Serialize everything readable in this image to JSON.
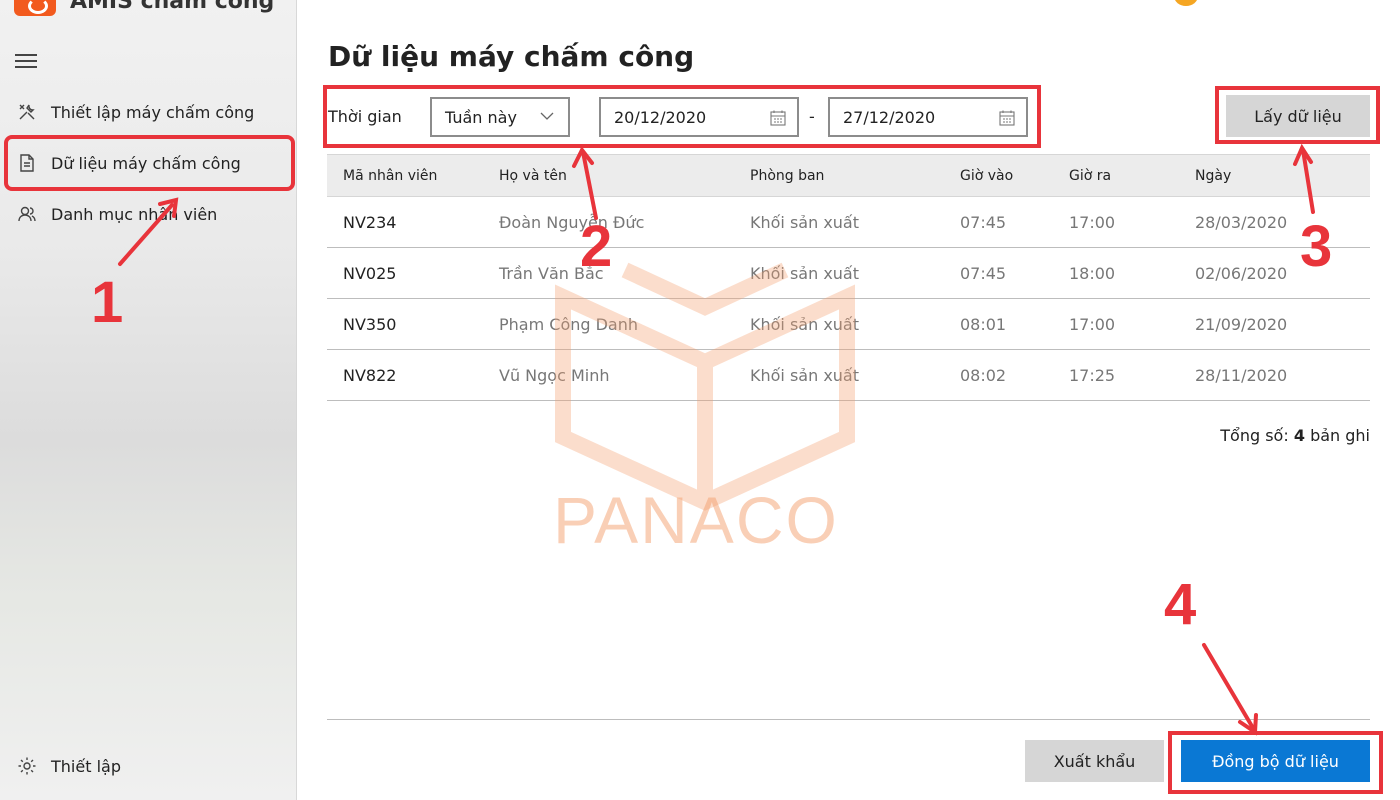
{
  "app": {
    "title": "AMIS chấm công"
  },
  "sidebar": {
    "items": [
      {
        "label": "Thiết lập máy chấm công",
        "icon": "tools-icon"
      },
      {
        "label": "Dữ liệu máy chấm công",
        "icon": "document-icon"
      },
      {
        "label": "Danh mục nhân viên",
        "icon": "users-icon"
      }
    ],
    "settings_label": "Thiết lập"
  },
  "main": {
    "title": "Dữ liệu máy chấm công",
    "filter": {
      "label": "Thời gian",
      "period": "Tuần này",
      "date_from": "20/12/2020",
      "date_separator": "-",
      "date_to": "27/12/2020"
    },
    "fetch_label": "Lấy dữ liệu",
    "table": {
      "headers": [
        "Mã nhân viên",
        "Họ và tên",
        "Phòng ban",
        "Giờ vào",
        "Giờ ra",
        "Ngày"
      ],
      "rows": [
        [
          "NV234",
          "Đoàn Nguyễn Đức",
          "Khối sản xuất",
          "07:45",
          "17:00",
          "28/03/2020"
        ],
        [
          "NV025",
          "Trần Văn Bắc",
          "Khối sản xuất",
          "07:45",
          "18:00",
          "02/06/2020"
        ],
        [
          "NV350",
          "Phạm Công Danh",
          "Khối sản xuất",
          "08:01",
          "17:00",
          "21/09/2020"
        ],
        [
          "NV822",
          "Vũ Ngọc Minh",
          "Khối sản xuất",
          "08:02",
          "17:25",
          "28/11/2020"
        ]
      ]
    },
    "total": {
      "prefix": "Tổng số:",
      "count": "4",
      "suffix": "bản ghi"
    },
    "export_label": "Xuất khẩu",
    "sync_label": "Đồng bộ dữ liệu"
  },
  "watermark": {
    "text": "PANACO"
  },
  "annotations": [
    "1",
    "2",
    "3",
    "4"
  ],
  "colors": {
    "annotation": "#e8343b",
    "primary": "#0a78d4",
    "brand": "#f25a1e"
  }
}
